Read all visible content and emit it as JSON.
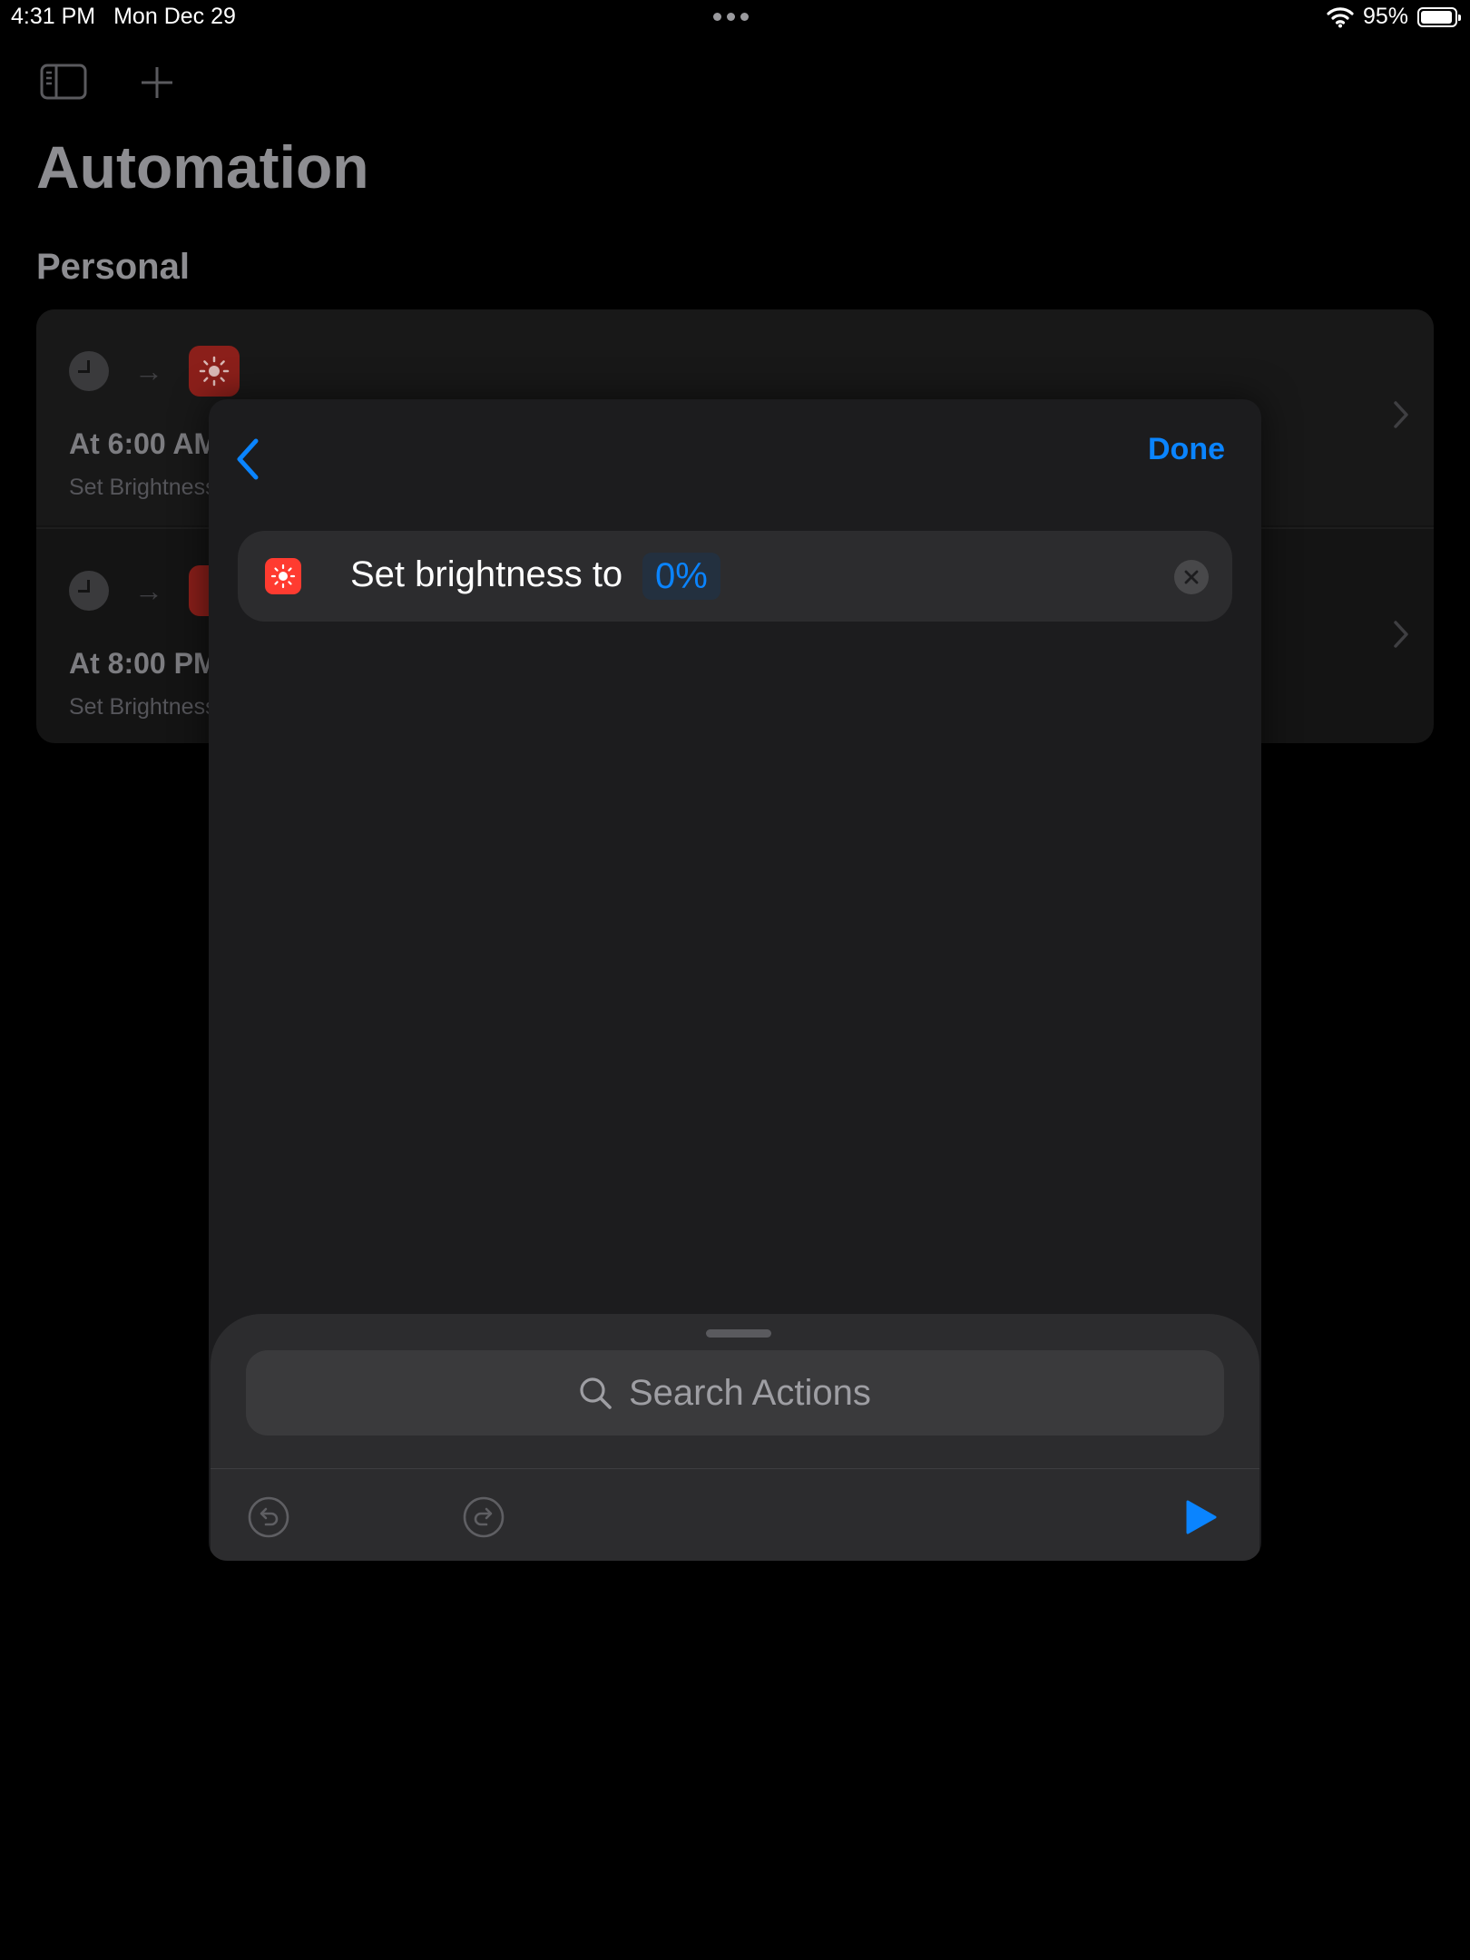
{
  "status_bar": {
    "time": "4:31 PM",
    "date": "Mon Dec 29",
    "battery_percent": "95%",
    "battery_level": 0.95,
    "icons": [
      "multitask-dots-icon",
      "wifi-icon",
      "battery-icon"
    ]
  },
  "background": {
    "toolbar_icons": [
      "sidebar-toggle-icon",
      "plus-icon"
    ],
    "page_title": "Automation",
    "section_title": "Personal",
    "automations": [
      {
        "title": "At 6:00 AM",
        "subtitle": "Set Brightness"
      },
      {
        "title": "At 8:00 PM",
        "subtitle": "Set Brightness"
      }
    ]
  },
  "modal": {
    "done_label": "Done",
    "action": {
      "icon": "brightness-icon",
      "label": "Set brightness to",
      "value": "0%"
    },
    "search": {
      "placeholder": "Search Actions"
    },
    "toolbar_icons": [
      "undo-icon",
      "redo-icon",
      "play-icon"
    ]
  },
  "colors": {
    "accent": "#0a84ff",
    "brightness_red": "#ff3b30",
    "modal_bg": "#1c1c1e",
    "sheet_bg": "#2c2c2e"
  }
}
